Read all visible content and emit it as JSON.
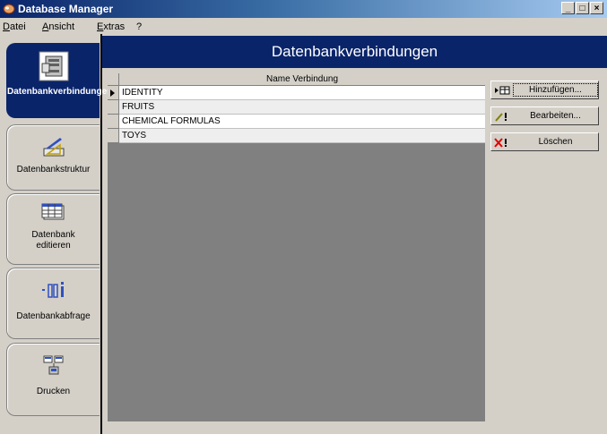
{
  "window": {
    "title": "Database Manager",
    "controls": {
      "minimize": "_",
      "maximize": "□",
      "close": "×"
    }
  },
  "menu": [
    {
      "pre": "",
      "u": "D",
      "post": "atei"
    },
    {
      "pre": "",
      "u": "A",
      "post": "nsicht"
    },
    {
      "pre": "",
      "u": "E",
      "post": "xtras"
    },
    {
      "pre": "",
      "u": "",
      "post": "?"
    }
  ],
  "sidebar": {
    "items": [
      {
        "label": "Datenbankverbindungen",
        "icon": "server-icon",
        "active": true
      },
      {
        "label": "Datenbankstruktur",
        "icon": "design-tools-icon",
        "active": false
      },
      {
        "label": "Datenbank editieren",
        "icon": "table-grid-icon",
        "active": false
      },
      {
        "label": "Datenbankabfrage",
        "icon": "query-icon",
        "active": false
      },
      {
        "label": "Drucken",
        "icon": "print-icon",
        "active": false
      }
    ]
  },
  "header": {
    "title": "Datenbankverbindungen"
  },
  "table": {
    "column": "Name Verbindung",
    "rows": [
      "IDENTITY",
      "FRUITS",
      "CHEMICAL FORMULAS",
      "TOYS"
    ],
    "selected_index": 0
  },
  "actions": {
    "add": "Hinzufügen...",
    "edit": "Bearbeiten...",
    "delete": "Löschen"
  },
  "colors": {
    "accent": "#0a246a",
    "face": "#d4d0c8",
    "grid_bg": "#808080"
  }
}
